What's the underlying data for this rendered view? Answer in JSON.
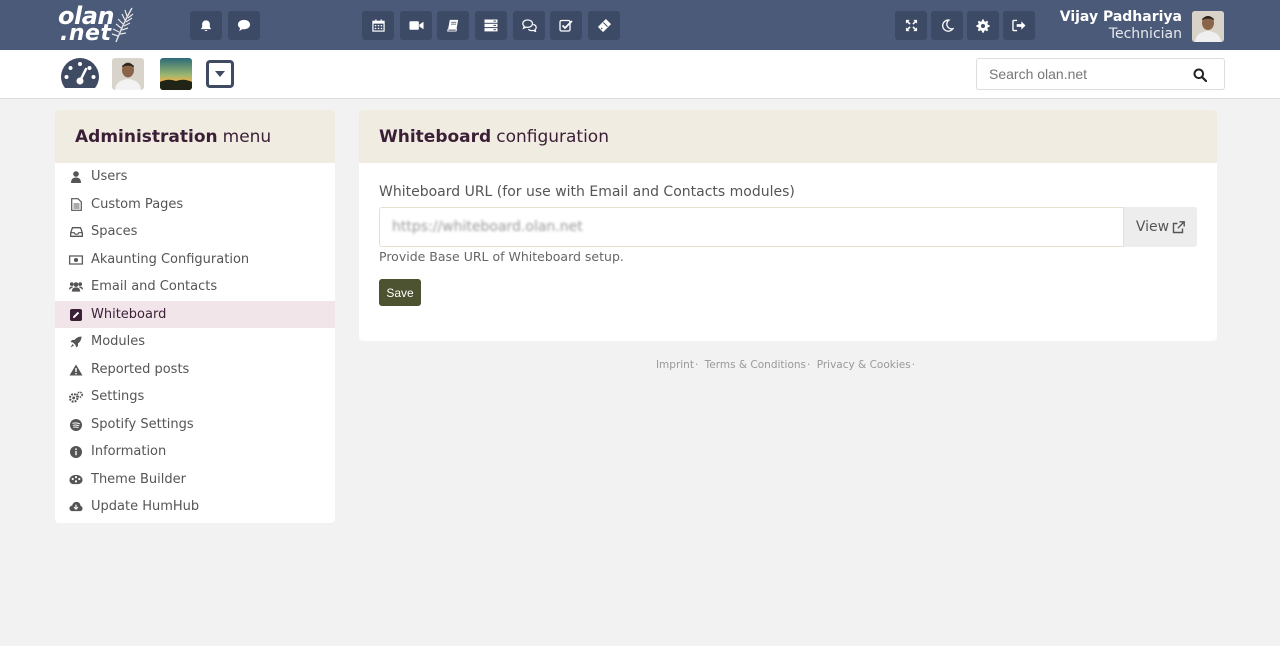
{
  "brand": {
    "logo_line1": "olan",
    "logo_line2": ".net"
  },
  "topbar": {
    "left_icons": [
      "bell-icon",
      "comment-icon"
    ],
    "center_icons": [
      "calendar-icon",
      "video-icon",
      "book-icon",
      "server-icon",
      "comments-icon",
      "task-check-icon",
      "ticket-icon"
    ],
    "right_icons": [
      "expand-icon",
      "moon-icon",
      "gear-icon",
      "logout-icon"
    ],
    "user_name": "Vijay Padhariya",
    "user_role": "Technician"
  },
  "search": {
    "placeholder": "Search olan.net"
  },
  "admin_menu": {
    "title_bold": "Administration",
    "title_rest": "menu",
    "items": [
      {
        "label": "Users",
        "icon": "user-icon"
      },
      {
        "label": "Custom Pages",
        "icon": "file-icon"
      },
      {
        "label": "Spaces",
        "icon": "inbox-icon"
      },
      {
        "label": "Akaunting Configuration",
        "icon": "money-icon"
      },
      {
        "label": "Email and Contacts",
        "icon": "users-icon"
      },
      {
        "label": "Whiteboard",
        "icon": "pencil-square-icon",
        "active": true
      },
      {
        "label": "Modules",
        "icon": "rocket-icon"
      },
      {
        "label": "Reported posts",
        "icon": "warning-icon"
      },
      {
        "label": "Settings",
        "icon": "cogs-icon"
      },
      {
        "label": "Spotify Settings",
        "icon": "spotify-icon"
      },
      {
        "label": "Information",
        "icon": "info-icon"
      },
      {
        "label": "Theme Builder",
        "icon": "palette-icon"
      },
      {
        "label": "Update HumHub",
        "icon": "cloud-download-icon"
      }
    ]
  },
  "config": {
    "title_bold": "Whiteboard",
    "title_rest": "configuration",
    "field_label": "Whiteboard URL (for use with Email and Contacts modules)",
    "url_value": "https://whiteboard.olan.net",
    "view_label": "View",
    "help": "Provide Base URL of Whiteboard setup.",
    "save_label": "Save"
  },
  "footer": {
    "links": [
      "Imprint",
      "Terms & Conditions",
      "Privacy & Cookies"
    ]
  },
  "colors": {
    "topbar": "#4b5a78",
    "accent": "#3b1f36",
    "panel_head": "#f0ece1",
    "save": "#4d5330"
  }
}
